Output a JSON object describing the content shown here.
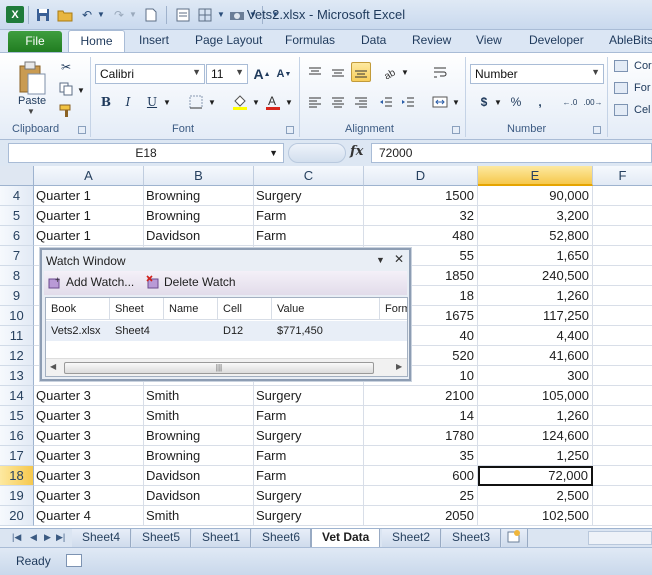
{
  "window": {
    "title": "Vets2.xlsx - Microsoft Excel"
  },
  "ribbon": {
    "tabs": [
      "File",
      "Home",
      "Insert",
      "Page Layout",
      "Formulas",
      "Data",
      "Review",
      "View",
      "Developer",
      "AbleBits"
    ],
    "active_tab": "Home",
    "font_name": "Calibri",
    "font_size": "11",
    "number_format": "Number",
    "paste_label": "Paste",
    "groups": {
      "clipboard": "Clipboard",
      "font": "Font",
      "alignment": "Alignment",
      "number": "Number"
    },
    "cutoff_labels": [
      "Cor",
      "For",
      "Cel"
    ],
    "font_buttons": {
      "bold": "B",
      "italic": "I",
      "underline": "U",
      "grow": "A",
      "shrink": "A"
    },
    "number_buttons": {
      "currency": "$",
      "percent": "%",
      "comma": ","
    }
  },
  "formula_bar": {
    "name_box": "E18",
    "fx": "fx",
    "formula": "72000"
  },
  "grid": {
    "columns": [
      "A",
      "B",
      "C",
      "D",
      "E",
      "F"
    ],
    "selected_column": "E",
    "selected_row": "18",
    "rows": [
      {
        "row": "4",
        "a": "Quarter 1",
        "b": "Browning",
        "c": "Surgery",
        "d": "1500",
        "e": "90,000"
      },
      {
        "row": "5",
        "a": "Quarter 1",
        "b": "Browning",
        "c": "Farm",
        "d": "32",
        "e": "3,200"
      },
      {
        "row": "6",
        "a": "Quarter 1",
        "b": "Davidson",
        "c": "Farm",
        "d": "480",
        "e": "52,800"
      },
      {
        "row": "7",
        "a": "",
        "b": "",
        "c": "",
        "d": "55",
        "e": "1,650"
      },
      {
        "row": "8",
        "a": "",
        "b": "",
        "c": "",
        "d": "1850",
        "e": "240,500"
      },
      {
        "row": "9",
        "a": "",
        "b": "",
        "c": "",
        "d": "18",
        "e": "1,260"
      },
      {
        "row": "10",
        "a": "",
        "b": "",
        "c": "",
        "d": "1675",
        "e": "117,250"
      },
      {
        "row": "11",
        "a": "",
        "b": "",
        "c": "",
        "d": "40",
        "e": "4,400"
      },
      {
        "row": "12",
        "a": "",
        "b": "",
        "c": "",
        "d": "520",
        "e": "41,600"
      },
      {
        "row": "13",
        "a": "",
        "b": "",
        "c": "",
        "d": "10",
        "e": "300"
      },
      {
        "row": "14",
        "a": "Quarter 3",
        "b": "Smith",
        "c": "Surgery",
        "d": "2100",
        "e": "105,000"
      },
      {
        "row": "15",
        "a": "Quarter 3",
        "b": "Smith",
        "c": "Farm",
        "d": "14",
        "e": "1,260"
      },
      {
        "row": "16",
        "a": "Quarter 3",
        "b": "Browning",
        "c": "Surgery",
        "d": "1780",
        "e": "124,600"
      },
      {
        "row": "17",
        "a": "Quarter 3",
        "b": "Browning",
        "c": "Farm",
        "d": "35",
        "e": "1,250"
      },
      {
        "row": "18",
        "a": "Quarter 3",
        "b": "Davidson",
        "c": "Farm",
        "d": "600",
        "e": "72,000"
      },
      {
        "row": "19",
        "a": "Quarter 3",
        "b": "Davidson",
        "c": "Surgery",
        "d": "25",
        "e": "2,500"
      },
      {
        "row": "20",
        "a": "Quarter 4",
        "b": "Smith",
        "c": "Surgery",
        "d": "2050",
        "e": "102,500"
      }
    ]
  },
  "watch_window": {
    "title": "Watch Window",
    "add_label": "Add Watch...",
    "delete_label": "Delete Watch",
    "headers": [
      "Book",
      "Sheet",
      "Name",
      "Cell",
      "Value",
      "Form"
    ],
    "entries": [
      {
        "book": "Vets2.xlsx",
        "sheet": "Sheet4",
        "name": "",
        "cell": "D12",
        "value": "$771,450",
        "formula": ""
      }
    ]
  },
  "sheet_tabs": [
    "Sheet4",
    "Sheet5",
    "Sheet1",
    "Sheet6",
    "Vet Data",
    "Sheet2",
    "Sheet3"
  ],
  "active_sheet": "Vet Data",
  "status": {
    "text": "Ready"
  },
  "colors": {
    "selection_orange": "#f6c84d",
    "file_green": "#217d21",
    "ribbon_blue": "#dbe6f4"
  }
}
